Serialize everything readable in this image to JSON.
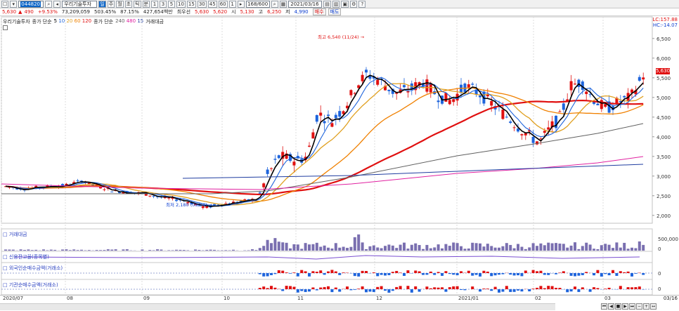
{
  "toolbar": {
    "code": "044820",
    "name": "우리기술투자",
    "count": "168/600",
    "date": "2021/03/16",
    "periods": [
      "1",
      "3",
      "5",
      "10",
      "15",
      "30",
      "45",
      "60",
      "1"
    ],
    "type_buttons": [
      "일",
      "주",
      "월",
      "초",
      "틱",
      "분"
    ]
  },
  "quote": {
    "price": "5,630",
    "change": "490",
    "change_pct": "+9.53%",
    "volume": "73,209,059",
    "volume_pct": "503.45%",
    "turnover": "87.15%",
    "amount": "427,654백만",
    "basis_label": "최우선",
    "ask": "5,630",
    "bid": "5,620",
    "open_label": "시",
    "open": "5,130",
    "high_label": "고",
    "high": "6,250",
    "low_label": "저",
    "low": "4,990",
    "buy_label": "매수",
    "sell_label": "매도"
  },
  "legend": {
    "name": "우리기술투자",
    "ma_label": "종가 단순",
    "ma_periods": [
      {
        "p": "5",
        "color": "#000000"
      },
      {
        "p": "10",
        "color": "#1e64dc"
      },
      {
        "p": "20",
        "color": "#e0a020"
      },
      {
        "p": "60",
        "color": "#f08000"
      },
      {
        "p": "120",
        "color": "#e01010"
      }
    ],
    "ma2_label": "종가 단순",
    "ma2_periods": [
      {
        "p": "240",
        "color": "#606060"
      },
      {
        "p": "480",
        "color": "#e020a0"
      },
      {
        "p": "15",
        "color": "#1e3ca0"
      }
    ],
    "volume_label": "거래대금"
  },
  "hilo": {
    "lc": "LC:157.88",
    "hc": "HC:-14.07"
  },
  "annotations": {
    "high": "최고 6,540 (11/24) →",
    "low": "최저 2,180 (09/24) →"
  },
  "price_axis": [
    "6,500",
    "6,000",
    "5,500",
    "5,000",
    "4,500",
    "4,000",
    "3,500",
    "3,000",
    "2,500",
    "2,000"
  ],
  "current_price_tag": "5,630",
  "subpanels": [
    {
      "label": "□ 거래대금",
      "axis": [
        "500,000",
        "0"
      ]
    },
    {
      "label": "□ 신용잔고율(종목별)",
      "axis": []
    },
    {
      "label": "□ 외국인순매수금액(거래소)",
      "axis": [
        "0"
      ]
    },
    {
      "label": "□ 기관순매수금액(거래소)",
      "axis": [
        "0"
      ]
    }
  ],
  "x_axis": [
    "2020/07",
    "08",
    "09",
    "10",
    "11",
    "12",
    "2021/01",
    "02",
    "03"
  ],
  "x_axis_end": "03/16",
  "colors": {
    "up": "#e01010",
    "down": "#1e64dc",
    "accent": "#0a64c8"
  }
}
